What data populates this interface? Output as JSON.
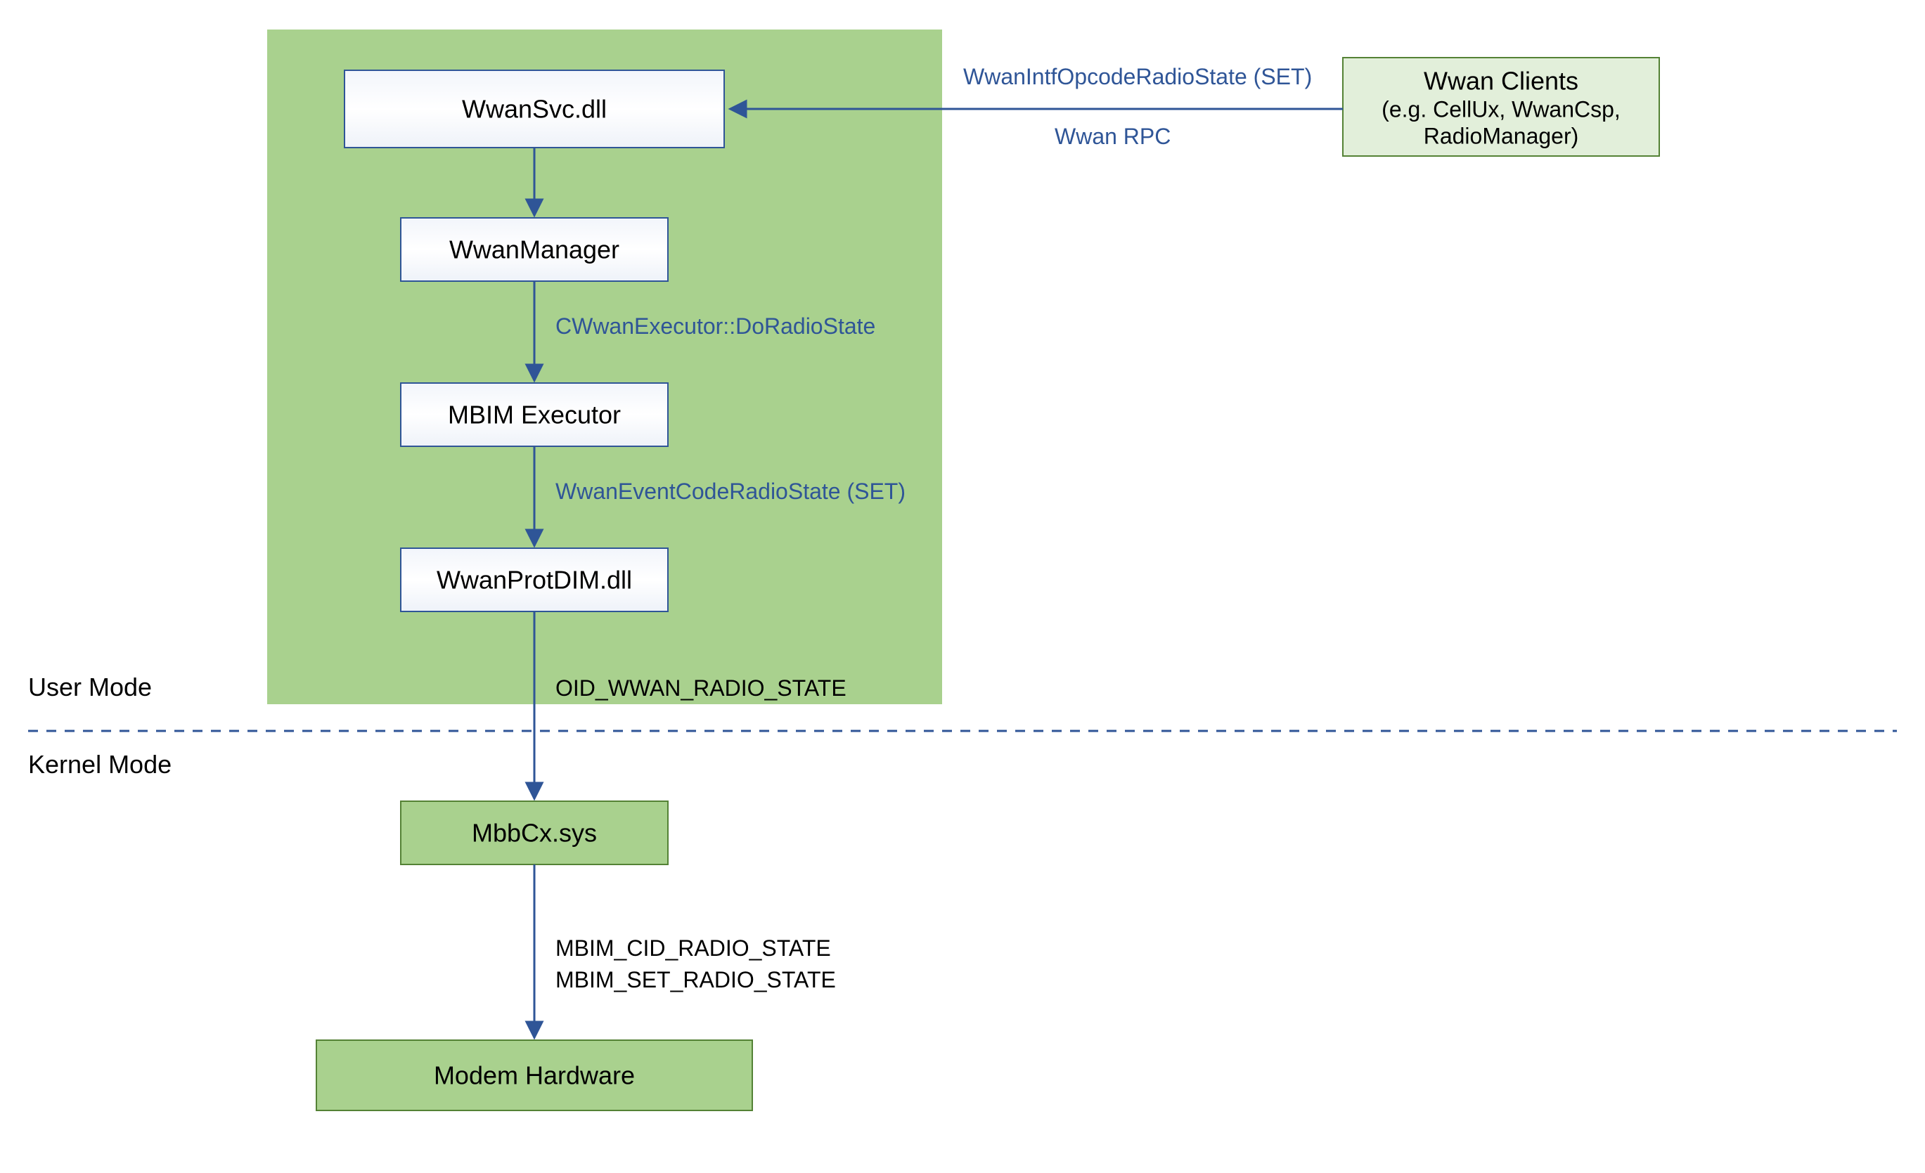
{
  "modes": {
    "user": "User Mode",
    "kernel": "Kernel Mode"
  },
  "boxes": {
    "wwanSvc": "WwanSvc.dll",
    "wwanManager": "WwanManager",
    "mbimExecutor": "MBIM Executor",
    "wwanProtDim": "WwanProtDIM.dll",
    "mbbCx": "MbbCx.sys",
    "modemHw": "Modem Hardware",
    "clientsTitle": "Wwan Clients",
    "clientsSub": "(e.g. CellUx, WwanCsp,",
    "clientsSub2": "RadioManager)"
  },
  "labels": {
    "rpcTop": "WwanIntfOpcodeRadioState (SET)",
    "rpcBottom": "Wwan RPC",
    "execCall": "CWwanExecutor::DoRadioState",
    "eventCode": "WwanEventCodeRadioState (SET)",
    "oid": "OID_WWAN_RADIO_STATE",
    "mbim1": "MBIM_CID_RADIO_STATE",
    "mbim2": "MBIM_SET_RADIO_STATE"
  },
  "colors": {
    "blue": "#2f5597",
    "greenFill": "#a9d18e",
    "greenStroke": "#548235",
    "greenLight": "#e2efda"
  }
}
